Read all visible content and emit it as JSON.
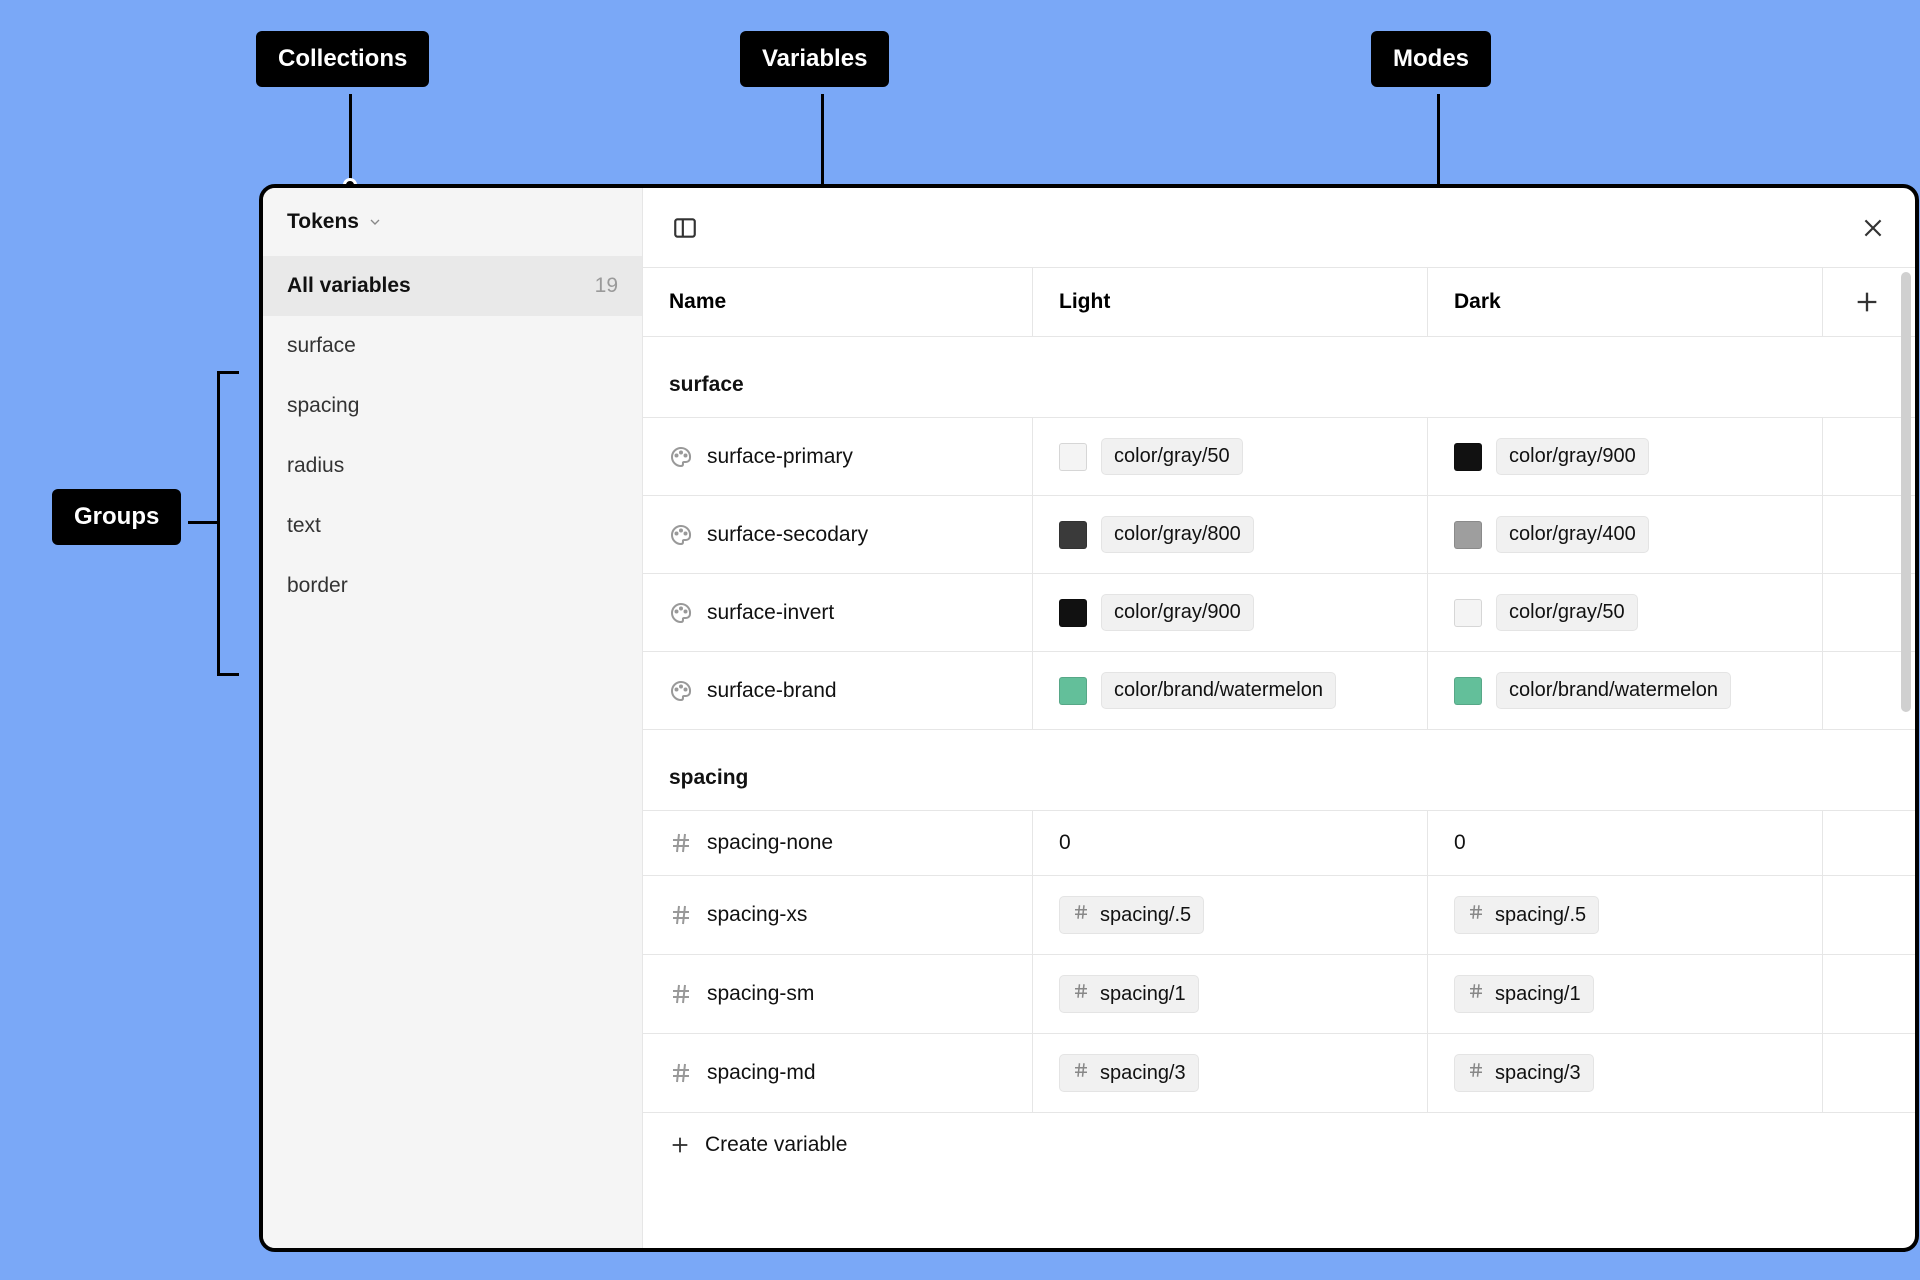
{
  "annotations": {
    "collections": "Collections",
    "variables": "Variables",
    "modes": "Modes",
    "groups": "Groups"
  },
  "collection": {
    "name": "Tokens"
  },
  "sidebar": {
    "all_label": "All variables",
    "all_count": "19",
    "groups": [
      "surface",
      "spacing",
      "radius",
      "text",
      "border"
    ]
  },
  "columns": {
    "name": "Name",
    "modes": [
      "Light",
      "Dark"
    ]
  },
  "sections": [
    {
      "title": "surface",
      "rows": [
        {
          "type": "color",
          "name": "surface-primary",
          "vals": [
            {
              "swatch": "#f4f4f4",
              "ref": "color/gray/50"
            },
            {
              "swatch": "#111111",
              "ref": "color/gray/900"
            }
          ]
        },
        {
          "type": "color",
          "name": "surface-secodary",
          "vals": [
            {
              "swatch": "#3a3a3a",
              "ref": "color/gray/800"
            },
            {
              "swatch": "#9e9e9e",
              "ref": "color/gray/400"
            }
          ]
        },
        {
          "type": "color",
          "name": "surface-invert",
          "vals": [
            {
              "swatch": "#111111",
              "ref": "color/gray/900"
            },
            {
              "swatch": "#f4f4f4",
              "ref": "color/gray/50"
            }
          ]
        },
        {
          "type": "color",
          "name": "surface-brand",
          "vals": [
            {
              "swatch": "#63bf9a",
              "ref": "color/brand/watermelon"
            },
            {
              "swatch": "#63bf9a",
              "ref": "color/brand/watermelon"
            }
          ]
        }
      ]
    },
    {
      "title": "spacing",
      "rows": [
        {
          "type": "number",
          "name": "spacing-none",
          "vals": [
            {
              "raw": "0"
            },
            {
              "raw": "0"
            }
          ]
        },
        {
          "type": "number",
          "name": "spacing-xs",
          "vals": [
            {
              "numref": "spacing/.5"
            },
            {
              "numref": "spacing/.5"
            }
          ]
        },
        {
          "type": "number",
          "name": "spacing-sm",
          "vals": [
            {
              "numref": "spacing/1"
            },
            {
              "numref": "spacing/1"
            }
          ]
        },
        {
          "type": "number",
          "name": "spacing-md",
          "vals": [
            {
              "numref": "spacing/3"
            },
            {
              "numref": "spacing/3"
            }
          ]
        }
      ]
    }
  ],
  "footer": {
    "create_label": "Create variable"
  }
}
